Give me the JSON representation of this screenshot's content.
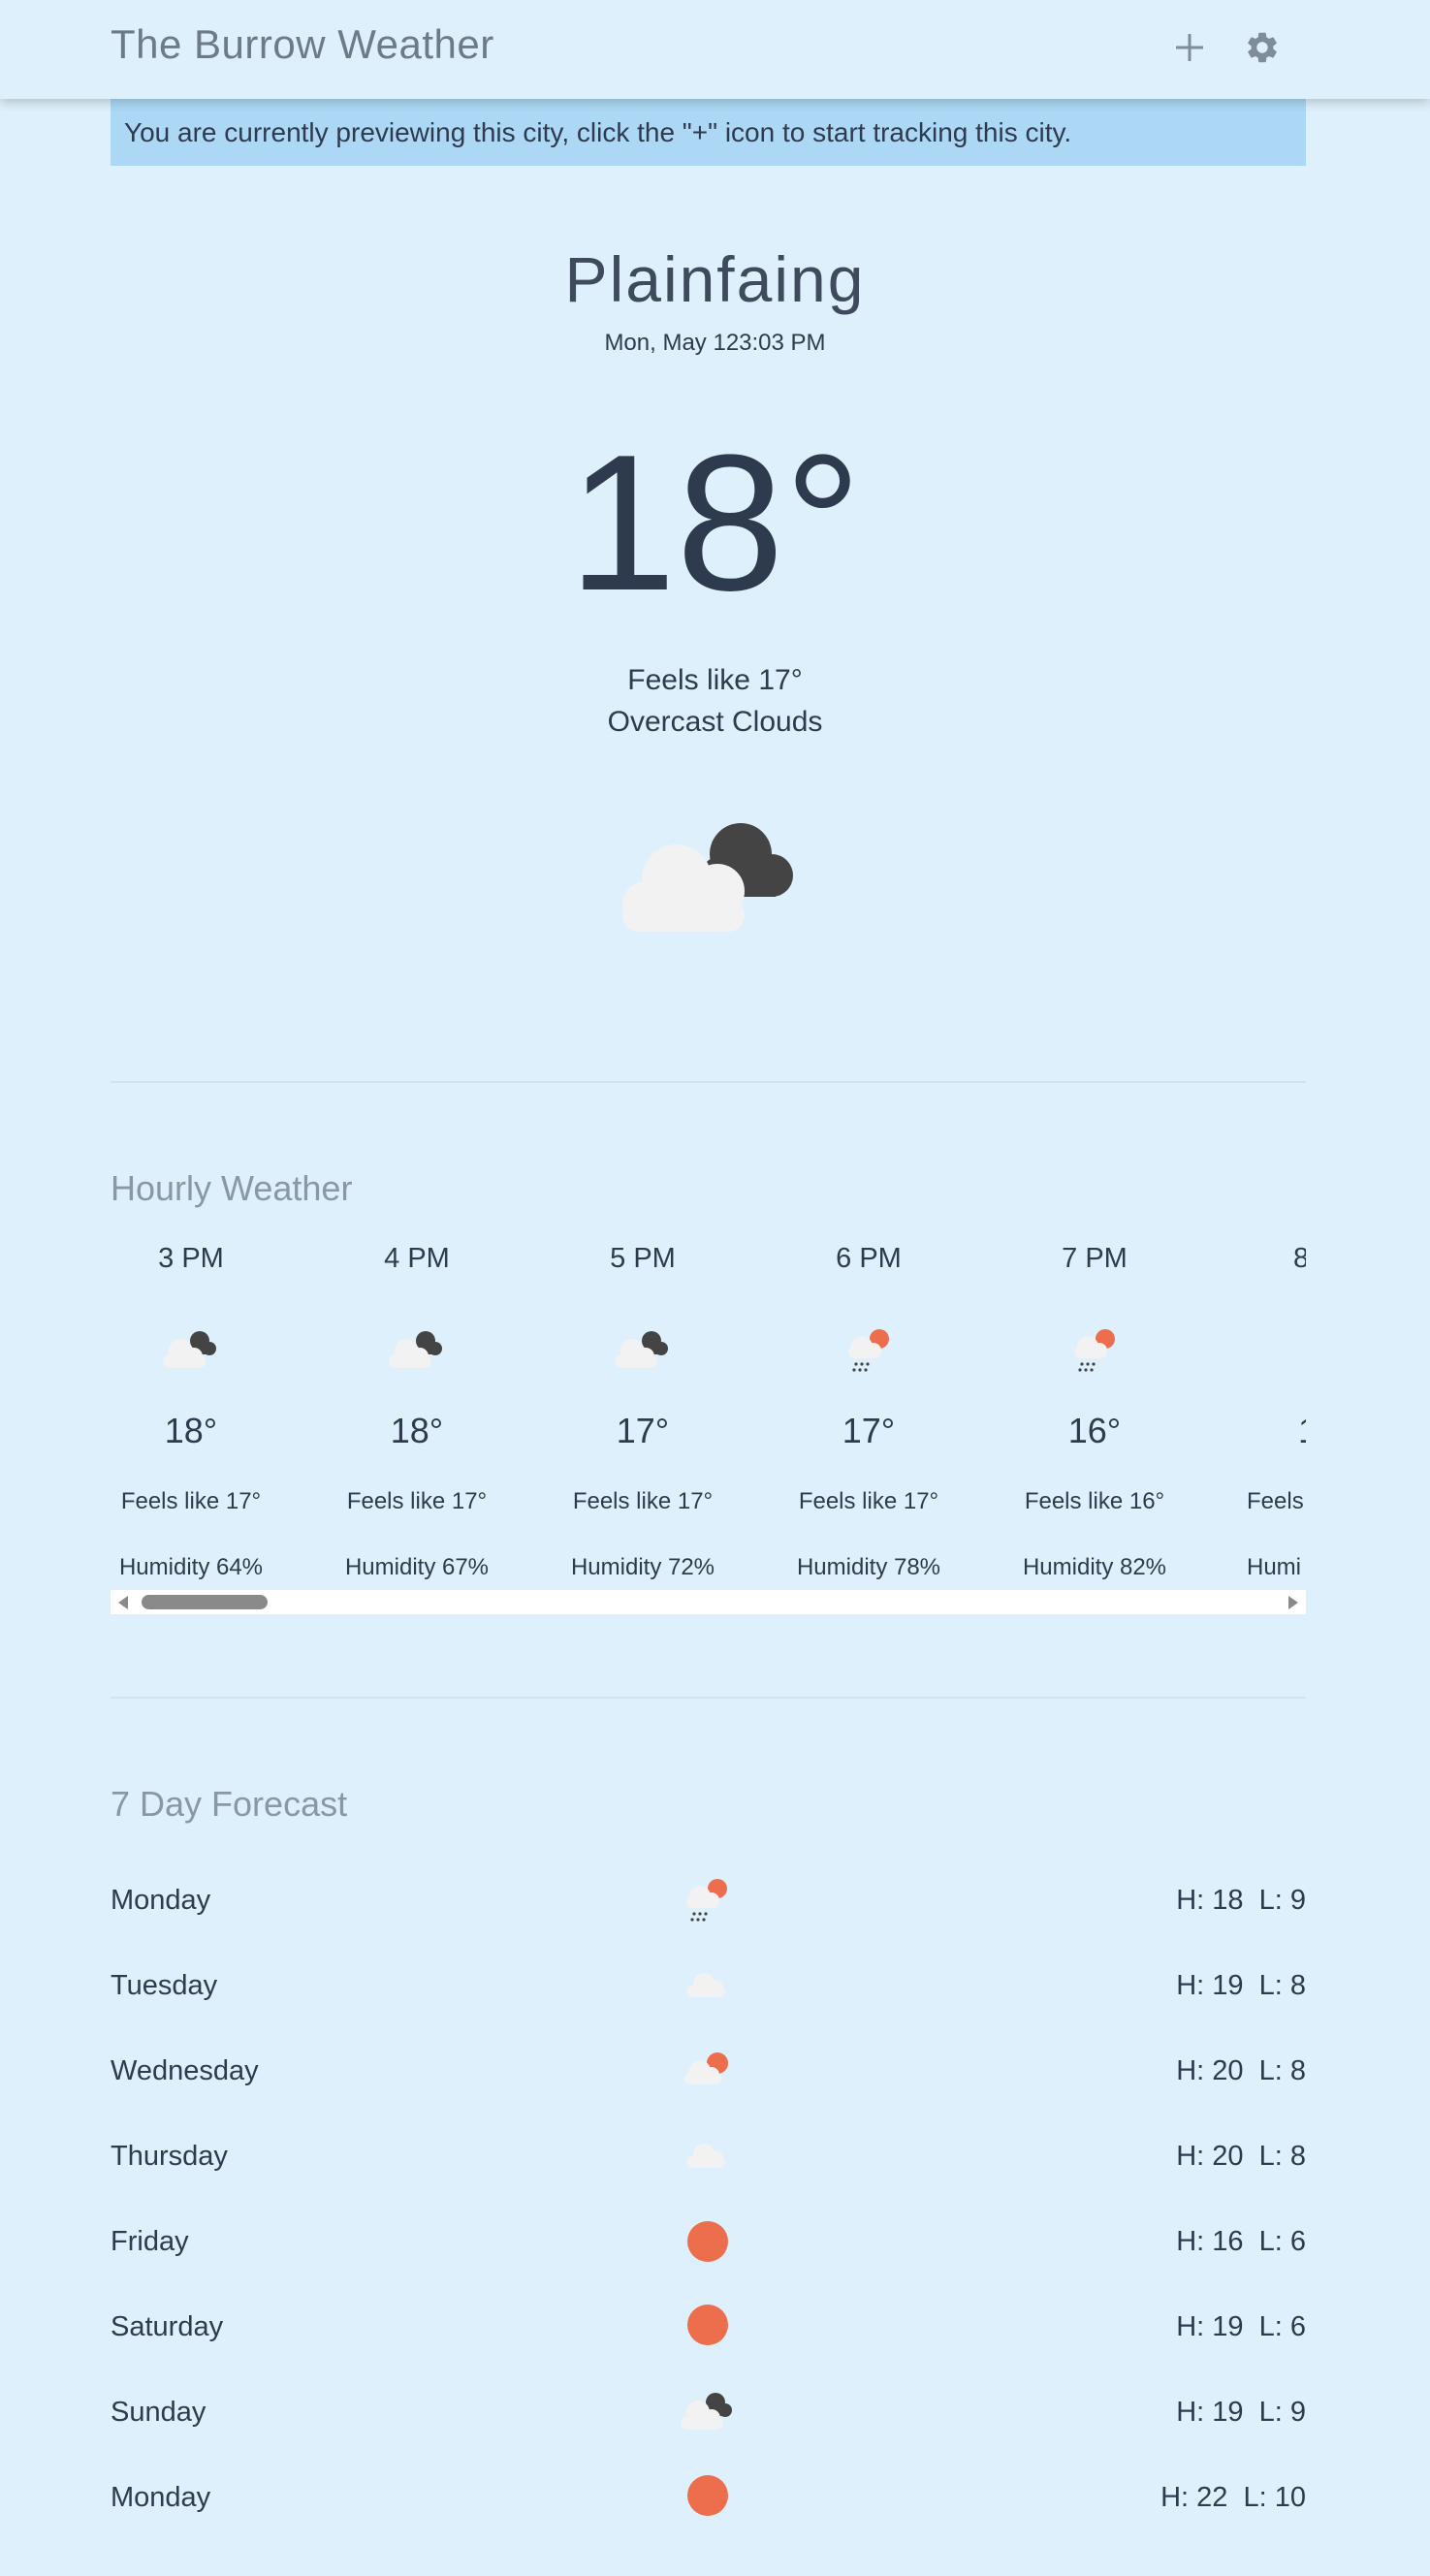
{
  "header": {
    "title": "The Burrow Weather",
    "add_icon": "plus-icon",
    "settings_icon": "gear-icon"
  },
  "banner": {
    "text": "You are currently previewing this city, click the \"+\" icon to start tracking this city."
  },
  "current": {
    "city": "Plainfaing",
    "datetime": "Mon, May 123:03 PM",
    "temperature": "18°",
    "feels_like": "Feels like 17°",
    "condition": "Overcast Clouds",
    "icon": "overcast-clouds-icon"
  },
  "hourly": {
    "title": "Hourly Weather",
    "items": [
      {
        "time": "3 PM",
        "icon": "overcast-clouds-icon",
        "temp": "18°",
        "feels": "Feels like 17°",
        "humidity": "Humidity 64%"
      },
      {
        "time": "4 PM",
        "icon": "overcast-clouds-icon",
        "temp": "18°",
        "feels": "Feels like 17°",
        "humidity": "Humidity 67%"
      },
      {
        "time": "5 PM",
        "icon": "overcast-clouds-icon",
        "temp": "17°",
        "feels": "Feels like 17°",
        "humidity": "Humidity 72%"
      },
      {
        "time": "6 PM",
        "icon": "sun-rain-icon",
        "temp": "17°",
        "feels": "Feels like 17°",
        "humidity": "Humidity 78%"
      },
      {
        "time": "7 PM",
        "icon": "sun-rain-icon",
        "temp": "16°",
        "feels": "Feels like 16°",
        "humidity": "Humidity 82%"
      },
      {
        "time": "8",
        "icon": "partial-icon",
        "temp": "1",
        "feels": "Feels",
        "humidity": "Humi"
      }
    ]
  },
  "forecast": {
    "title": "7 Day Forecast",
    "days": [
      {
        "day": "Monday",
        "icon": "sun-rain-icon",
        "hl": "H: 18  L: 9"
      },
      {
        "day": "Tuesday",
        "icon": "cloud-icon",
        "hl": "H: 19  L: 8"
      },
      {
        "day": "Wednesday",
        "icon": "sun-cloud-icon",
        "hl": "H: 20  L: 8"
      },
      {
        "day": "Thursday",
        "icon": "cloud-icon",
        "hl": "H: 20  L: 8"
      },
      {
        "day": "Friday",
        "icon": "sun-icon",
        "hl": "H: 16  L: 6"
      },
      {
        "day": "Saturday",
        "icon": "sun-icon",
        "hl": "H: 19  L: 6"
      },
      {
        "day": "Sunday",
        "icon": "overcast-clouds-icon",
        "hl": "H: 19  L: 9"
      },
      {
        "day": "Monday",
        "icon": "sun-icon",
        "hl": "H: 22  L: 10"
      }
    ]
  },
  "colors": {
    "background": "#def0fb",
    "banner": "#acd7f5",
    "sun": "#ec6e4c",
    "cloud_light": "#f2f2f2",
    "cloud_dark": "#444444"
  }
}
